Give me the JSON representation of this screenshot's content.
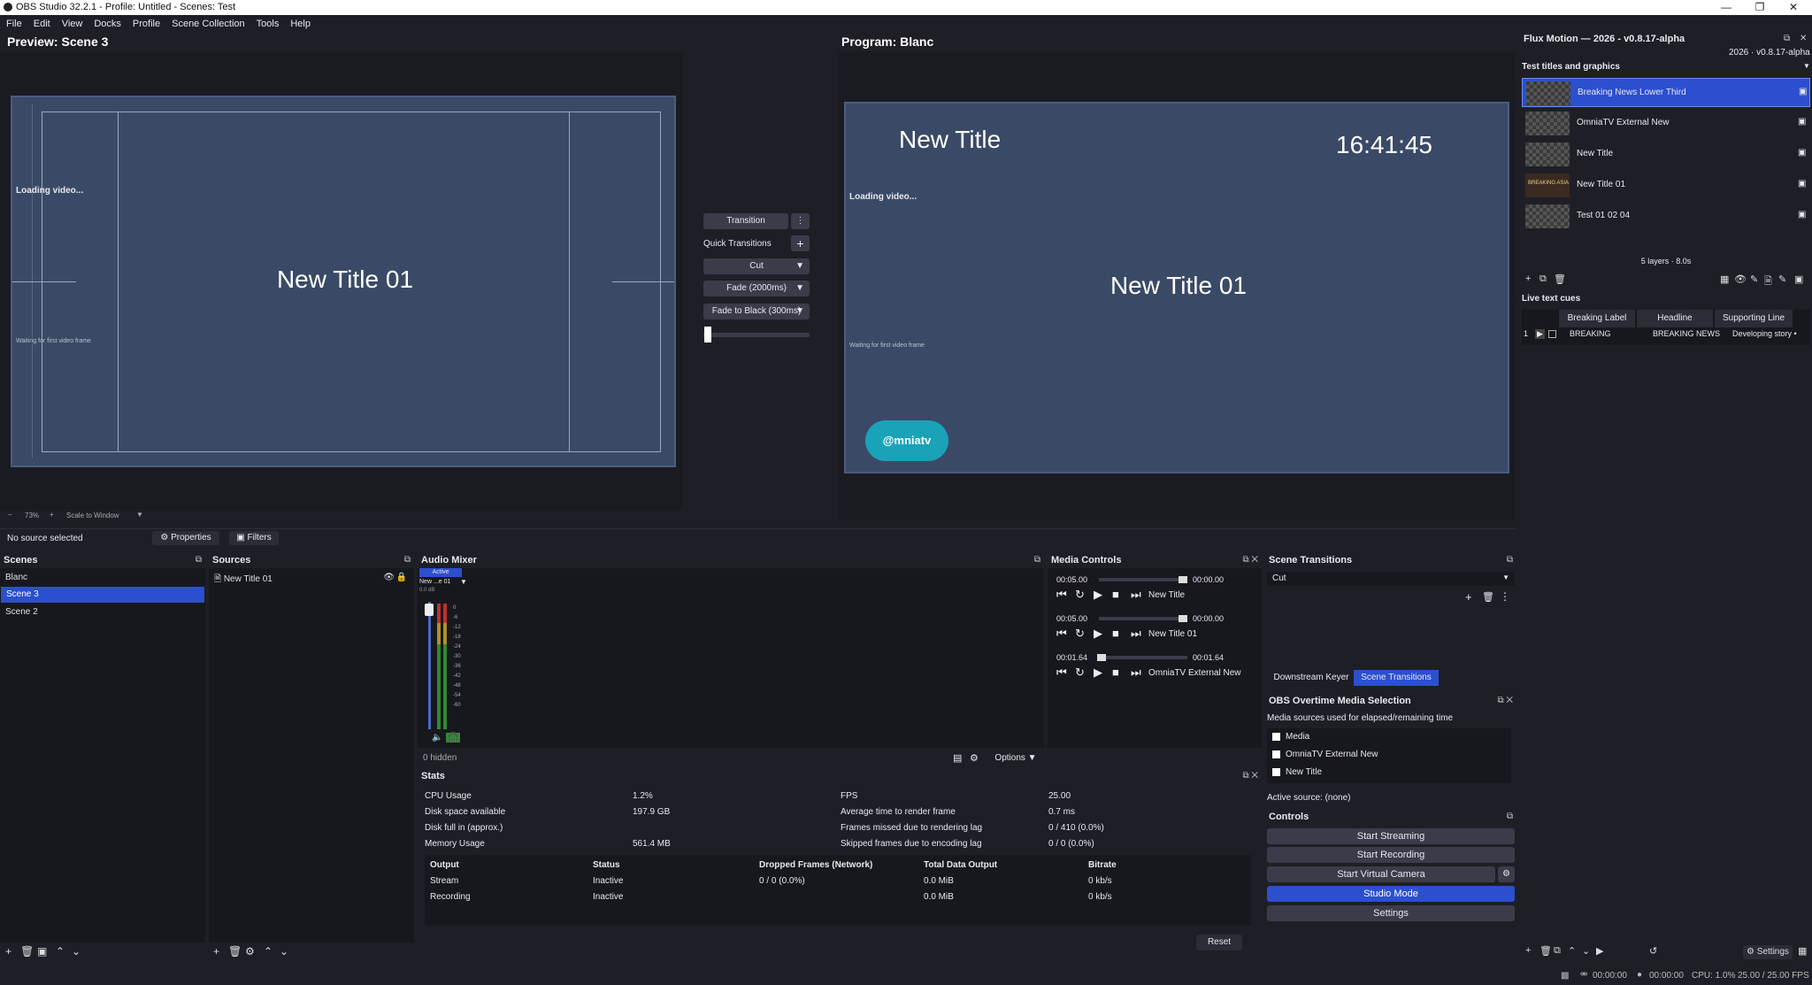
{
  "window": {
    "title": "OBS Studio 32.2.1 - Profile: Untitled - Scenes: Test"
  },
  "menu": [
    "File",
    "Edit",
    "View",
    "Docks",
    "Profile",
    "Scene Collection",
    "Tools",
    "Help"
  ],
  "preview": {
    "title": "Preview: Scene 3",
    "loading": "Loading video...",
    "waiting": "Waiting for first video frame",
    "center_text": "New Title 01",
    "zoom": "73%",
    "scale_mode": "Scale to Window"
  },
  "program": {
    "title": "Program: Blanc",
    "title_text": "New Title",
    "clock": "16:41:45",
    "loading": "Loading video...",
    "center_text": "New Title 01",
    "waiting": "Waiting for first video frame",
    "logo": "@mniatv"
  },
  "transition_panel": {
    "transition": "Transition",
    "quick": "Quick Transitions",
    "cut": "Cut",
    "fade": "Fade (2000ms)",
    "fade_black": "Fade to Black (300ms)"
  },
  "source_bar": {
    "no_source": "No source selected",
    "properties": "Properties",
    "filters": "Filters"
  },
  "scenes": {
    "title": "Scenes",
    "items": [
      "Blanc",
      "Scene 3",
      "Scene 2"
    ]
  },
  "sources": {
    "title": "Sources",
    "items": [
      "New Title 01"
    ]
  },
  "audio": {
    "title": "Audio Mixer",
    "active": "Active",
    "track": "New ...e 01",
    "db": "0.0 dB",
    "scale": [
      "0",
      "-6",
      "-12",
      "-18",
      "-24",
      "-30",
      "-36",
      "-42",
      "-48",
      "-54",
      "-60"
    ],
    "hidden": "0 hidden",
    "options": "Options"
  },
  "media": {
    "title": "Media Controls",
    "items": [
      {
        "start": "00:05.00",
        "end": "00:00.00",
        "name": "New Title"
      },
      {
        "start": "00:05.00",
        "end": "00:00.00",
        "name": "New Title 01"
      },
      {
        "start": "00:01.64",
        "end": "00:01.64",
        "name": "OmniaTV External New"
      }
    ]
  },
  "scene_transitions": {
    "title": "Scene Transitions",
    "value": "Cut",
    "tab_downstream": "Downstream Keyer",
    "tab_transitions": "Scene Transitions"
  },
  "overtime": {
    "title": "OBS Overtime Media Selection",
    "desc": "Media sources used for elapsed/remaining time",
    "items": [
      "Media",
      "OmniaTV External New",
      "New Title"
    ],
    "active": "Active source: (none)"
  },
  "controls": {
    "title": "Controls",
    "start_streaming": "Start Streaming",
    "start_recording": "Start Recording",
    "start_virtual_camera": "Start Virtual Camera",
    "studio_mode": "Studio Mode",
    "settings": "Settings"
  },
  "stats": {
    "title": "Stats",
    "left": [
      [
        "CPU Usage",
        "1.2%"
      ],
      [
        "Disk space available",
        "197.9 GB"
      ],
      [
        "Disk full in (approx.)",
        ""
      ],
      [
        "Memory Usage",
        "561.4 MB"
      ]
    ],
    "right": [
      [
        "FPS",
        "25.00"
      ],
      [
        "Average time to render frame",
        "0.7 ms"
      ],
      [
        "Frames missed due to rendering lag",
        "0 / 410 (0.0%)"
      ],
      [
        "Skipped frames due to encoding lag",
        "0 / 0 (0.0%)"
      ]
    ],
    "columns": [
      "Output",
      "Status",
      "Dropped Frames (Network)",
      "Total Data Output",
      "Bitrate"
    ],
    "rows": [
      [
        "Stream",
        "Inactive",
        "0 / 0 (0.0%)",
        "0.0 MiB",
        "0 kb/s"
      ],
      [
        "Recording",
        "Inactive",
        "",
        "0.0 MiB",
        "0 kb/s"
      ]
    ],
    "reset": "Reset"
  },
  "flux": {
    "title": "Flux Motion — 2026 - v0.8.17-alpha",
    "version": "2026 · v0.8.17-alpha",
    "section": "Test titles and graphics",
    "items": [
      "Breaking News Lower Third",
      "OmniaTV External New",
      "New Title",
      "New Title 01",
      "Test 01 02 04"
    ],
    "thumb_text": "BREAKING ASIA",
    "layers": "5 layers · 8.0s",
    "cues_title": "Live text cues",
    "cue_columns": [
      "Breaking Label",
      "Headline",
      "Supporting Line"
    ],
    "cue_rows": [
      [
        "1",
        "BREAKING",
        "BREAKING NEWS",
        "Developing story •"
      ]
    ],
    "settings": "Settings"
  },
  "status": {
    "rec_time": "00:00:00",
    "stream_time": "00:00:00",
    "cpu": "CPU: 1.0%",
    "fps": "25.00 / 25.00 FPS"
  }
}
